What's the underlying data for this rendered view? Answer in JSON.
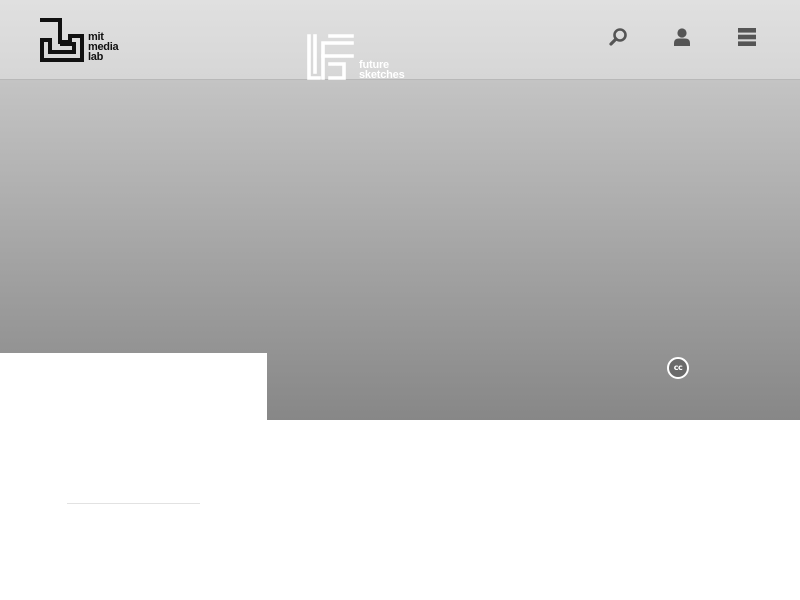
{
  "header": {
    "org_logo": {
      "lines": [
        "mit",
        "media",
        "lab"
      ],
      "icon": "media-lab-logo-icon"
    },
    "project_logo": {
      "lines": [
        "future",
        "sketches"
      ],
      "icon": "future-sketches-logo-icon"
    },
    "actions": {
      "search_icon": "search-icon",
      "user_icon": "user-icon",
      "menu_icon": "menu-icon"
    }
  },
  "hero": {
    "license_badge": "cc"
  },
  "colors": {
    "header_bg": "#dcdcdc",
    "hero_top": "#c4c4c4",
    "hero_bottom": "#878787",
    "icon_color": "#555555",
    "logo_dark": "#111111",
    "logo_light": "#ffffff"
  }
}
